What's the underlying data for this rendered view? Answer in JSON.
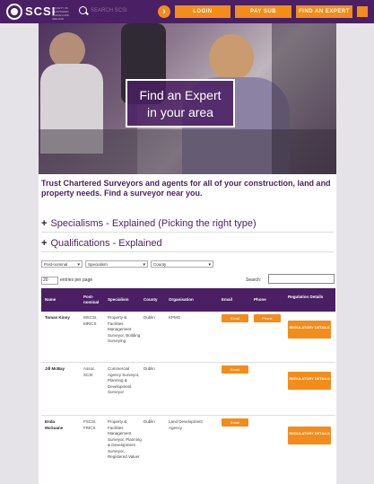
{
  "header": {
    "brand": "SCSI",
    "tagline": "SOCIETY OF CHARTERED SURVEYORS IRELAND",
    "search_placeholder": "SEARCH SCSI",
    "login_label": "LOGIN",
    "pay_sub_label": "PAY SUB",
    "find_expert_label": "FIND AN EXPERT"
  },
  "hero": {
    "title_line1": "Find an Expert",
    "title_line2": "in your area"
  },
  "intro": "Trust Chartered Surveyors and agents for all of your construction, land and property needs. Find a surveyor near you.",
  "accordions": [
    {
      "plus": "+",
      "label": "Specialisms - Explained (Picking the right type)"
    },
    {
      "plus": "+",
      "label": "Qualifications - Explained"
    }
  ],
  "filters": {
    "postnominal": "Post-nominal",
    "specialism": "Specialism",
    "county": "County"
  },
  "table_controls": {
    "entries_value": "20",
    "entries_label": "entries per page",
    "search_label": "Search:"
  },
  "columns": [
    "Name",
    "Post-nominal",
    "Specialism",
    "County",
    "Organisation",
    "Email",
    "Phone",
    "Regulation Details"
  ],
  "rows": [
    {
      "name": "Tomas Kinny",
      "postnominal": "MSCSI, MRICS",
      "specialism": "Property & Facilities Management Surveyor, Building Surveying",
      "county": "Dublin",
      "organisation": "KPMG",
      "email": "Email",
      "phone": "Phone",
      "regulation": "REGULATORY DETAILS"
    },
    {
      "name": "Jill McBay",
      "postnominal": "Assoc. SCSI",
      "specialism": "Commercial Agency Surveyor, Planning & Development Surveyor",
      "county": "Dublin",
      "organisation": "",
      "email": "Email",
      "phone": "",
      "regulation": "REGULATORY DETAILS"
    },
    {
      "name": "Enda McGuane",
      "postnominal": "FSCSI, FRICS",
      "specialism": "Property & Facilities Management Surveyor, Planning & Development Surveyor, Registered Valuer",
      "county": "Dublin",
      "organisation": "Land Development Agency",
      "email": "Email",
      "phone": "",
      "regulation": "REGULATORY DETAILS"
    }
  ],
  "colors": {
    "brand_purple": "#4a1f63",
    "accent_orange": "#f28c1a"
  }
}
